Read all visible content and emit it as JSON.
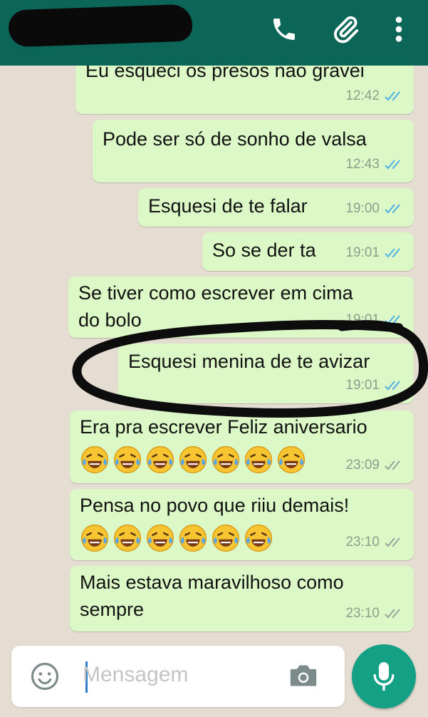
{
  "header": {
    "icons": [
      "phone-icon",
      "attach-icon",
      "more-vert-icon"
    ],
    "colors": {
      "bar": "#0b6658"
    }
  },
  "messages": [
    {
      "text": "Eu esqueci os presos não gravei",
      "time": "12:42",
      "ticks": "read"
    },
    {
      "text": "Pode ser só de sonho de valsa",
      "time": "12:43",
      "ticks": "read"
    },
    {
      "text": "Esquesi de te falar",
      "time": "19:00",
      "ticks": "read"
    },
    {
      "text": "So se der ta",
      "time": "19:01",
      "ticks": "read"
    },
    {
      "text": "Se tiver como escrever em cima\ndo bolo",
      "time": "19:01",
      "ticks": "read"
    },
    {
      "text": "Esquesi menina de te avizar",
      "time": "19:01",
      "ticks": "read"
    },
    {
      "text": "Era pra escrever Feliz aniversario",
      "emoji_count": 7,
      "time": "23:09",
      "ticks": "delivered"
    },
    {
      "text": "Pensa no povo que riiu demais!",
      "emoji_count": 6,
      "time": "23:10",
      "ticks": "delivered"
    },
    {
      "text": "Mais estava maravilhoso como\nsempre",
      "time": "23:10",
      "ticks": "delivered"
    }
  ],
  "composer": {
    "placeholder": "Mensagem",
    "icons": [
      "emoji-icon",
      "camera-icon",
      "mic-icon"
    ]
  },
  "colors": {
    "outgoing_bubble": "#dcf8c6",
    "read_ticks": "#4fb0e6",
    "delivered_ticks": "#9aa59a",
    "chat_bg": "#e6ddd2",
    "fab": "#14a085"
  }
}
